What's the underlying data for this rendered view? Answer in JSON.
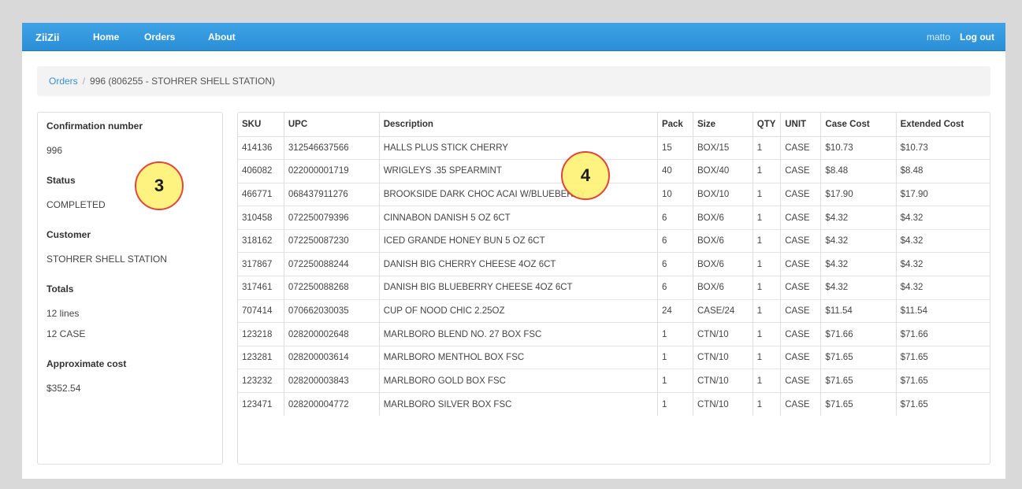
{
  "navbar": {
    "brand": "ZiiZii",
    "links": [
      "Home",
      "Orders",
      "About"
    ],
    "user": "matto",
    "logout": "Log out"
  },
  "breadcrumb": {
    "link": "Orders",
    "separator": "/",
    "current": "996 (806255 - STOHRER SHELL STATION)"
  },
  "sidebar": {
    "confirmation_label": "Confirmation number",
    "confirmation_value": "996",
    "status_label": "Status",
    "status_value": "COMPLETED",
    "customer_label": "Customer",
    "customer_value": "STOHRER SHELL STATION",
    "totals_label": "Totals",
    "totals_lines": "12 lines",
    "totals_case": "12 CASE",
    "cost_label": "Approximate cost",
    "cost_value": "$352.54"
  },
  "table": {
    "headers": [
      "SKU",
      "UPC",
      "Description",
      "Pack",
      "Size",
      "QTY",
      "UNIT",
      "Case Cost",
      "Extended Cost"
    ],
    "rows": [
      [
        "414136",
        "312546637566",
        "HALLS PLUS STICK CHERRY",
        "15",
        "BOX/15",
        "1",
        "CASE",
        "$10.73",
        "$10.73"
      ],
      [
        "406082",
        "022000001719",
        "WRIGLEYS .35 SPEARMINT",
        "40",
        "BOX/40",
        "1",
        "CASE",
        "$8.48",
        "$8.48"
      ],
      [
        "466771",
        "068437911276",
        "BROOKSIDE DARK CHOC ACAI W/BLUEBERRY",
        "10",
        "BOX/10",
        "1",
        "CASE",
        "$17.90",
        "$17.90"
      ],
      [
        "310458",
        "072250079396",
        "CINNABON DANISH 5 OZ 6CT",
        "6",
        "BOX/6",
        "1",
        "CASE",
        "$4.32",
        "$4.32"
      ],
      [
        "318162",
        "072250087230",
        "ICED GRANDE HONEY BUN 5 OZ 6CT",
        "6",
        "BOX/6",
        "1",
        "CASE",
        "$4.32",
        "$4.32"
      ],
      [
        "317867",
        "072250088244",
        "DANISH BIG CHERRY CHEESE 4OZ 6CT",
        "6",
        "BOX/6",
        "1",
        "CASE",
        "$4.32",
        "$4.32"
      ],
      [
        "317461",
        "072250088268",
        "DANISH BIG BLUEBERRY CHEESE 4OZ 6CT",
        "6",
        "BOX/6",
        "1",
        "CASE",
        "$4.32",
        "$4.32"
      ],
      [
        "707414",
        "070662030035",
        "CUP OF NOOD CHIC 2.25OZ",
        "24",
        "CASE/24",
        "1",
        "CASE",
        "$11.54",
        "$11.54"
      ],
      [
        "123218",
        "028200002648",
        "MARLBORO BLEND NO. 27 BOX FSC",
        "1",
        "CTN/10",
        "1",
        "CASE",
        "$71.66",
        "$71.66"
      ],
      [
        "123281",
        "028200003614",
        "MARLBORO MENTHOL BOX FSC",
        "1",
        "CTN/10",
        "1",
        "CASE",
        "$71.65",
        "$71.65"
      ],
      [
        "123232",
        "028200003843",
        "MARLBORO GOLD BOX FSC",
        "1",
        "CTN/10",
        "1",
        "CASE",
        "$71.65",
        "$71.65"
      ],
      [
        "123471",
        "028200004772",
        "MARLBORO SILVER BOX FSC",
        "1",
        "CTN/10",
        "1",
        "CASE",
        "$71.65",
        "$71.65"
      ]
    ]
  },
  "callouts": [
    "3",
    "4"
  ]
}
